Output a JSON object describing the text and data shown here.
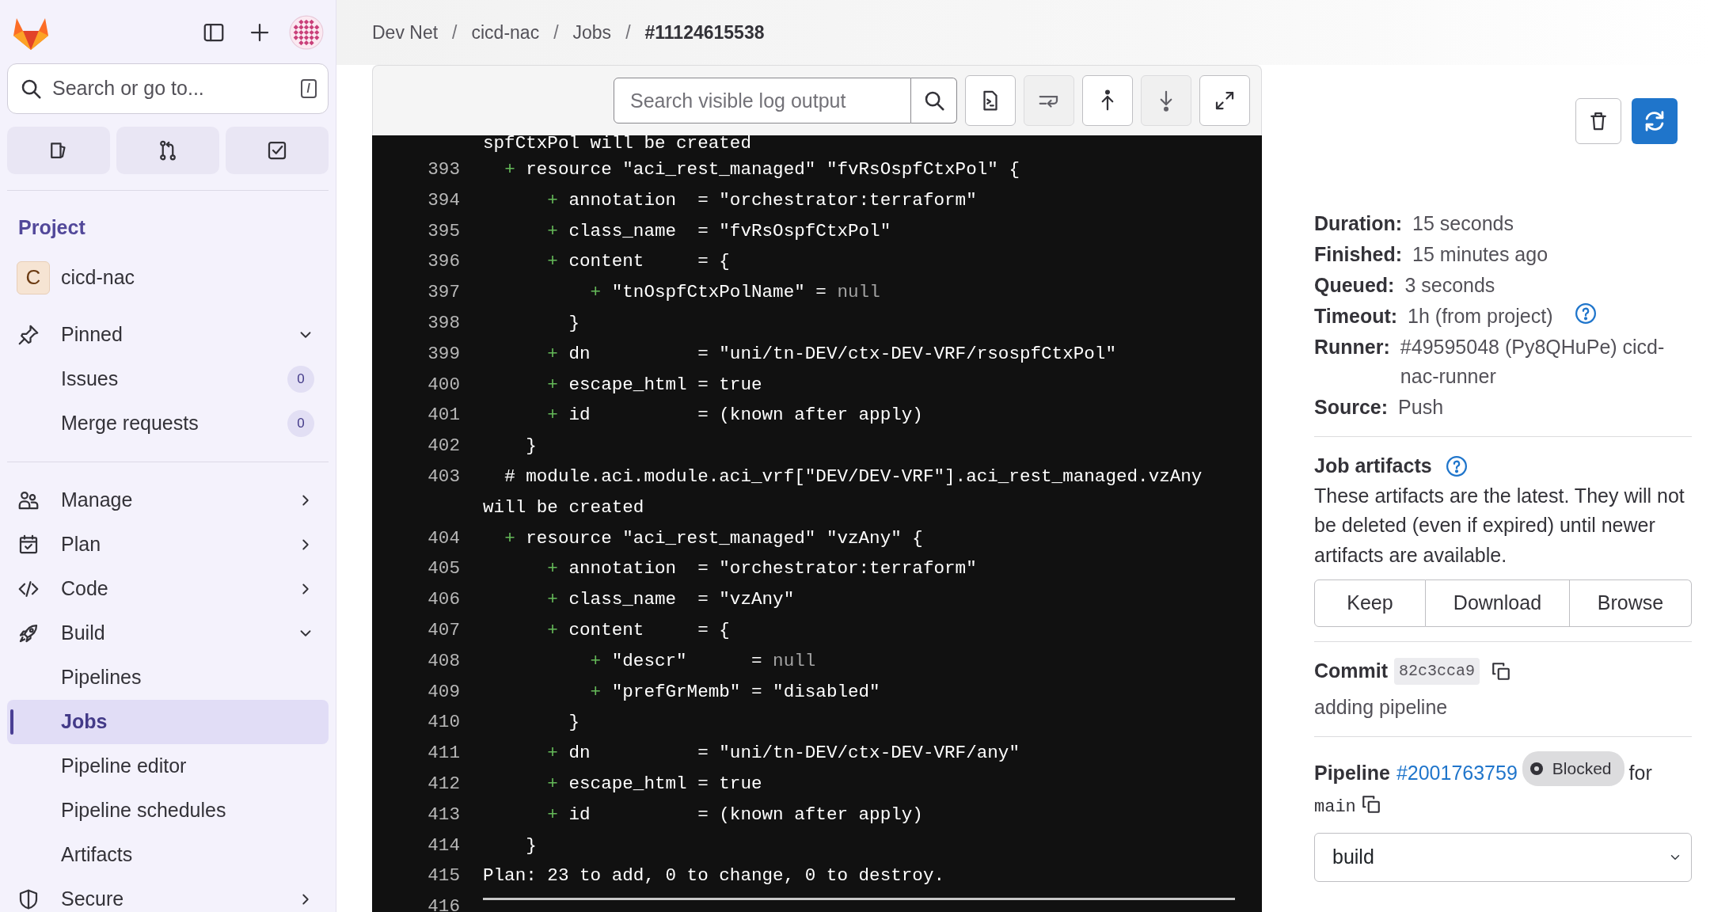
{
  "sidebar": {
    "search": {
      "placeholder": "Search or go to...",
      "shortcut": "/"
    },
    "section_title": "Project",
    "project": {
      "initial": "C",
      "name": "cicd-nac"
    },
    "pinned": {
      "label": "Pinned",
      "expanded": true,
      "items": [
        {
          "label": "Issues",
          "count": "0",
          "selected": false
        },
        {
          "label": "Merge requests",
          "count": "0",
          "selected": false
        }
      ]
    },
    "menu": [
      {
        "label": "Manage",
        "expanded": false
      },
      {
        "label": "Plan",
        "expanded": false
      },
      {
        "label": "Code",
        "expanded": false
      },
      {
        "label": "Build",
        "expanded": true,
        "children": [
          {
            "label": "Pipelines",
            "selected": false
          },
          {
            "label": "Jobs",
            "selected": true
          },
          {
            "label": "Pipeline editor",
            "selected": false
          },
          {
            "label": "Pipeline schedules",
            "selected": false
          },
          {
            "label": "Artifacts",
            "selected": false
          }
        ]
      },
      {
        "label": "Secure",
        "expanded": false
      }
    ]
  },
  "breadcrumbs": {
    "separator": "/",
    "items": [
      {
        "label": "Dev Net",
        "current": false
      },
      {
        "label": "cicd-nac",
        "current": false
      },
      {
        "label": "Jobs",
        "current": false
      },
      {
        "label": "#11124615538",
        "current": true
      }
    ]
  },
  "log": {
    "search": {
      "placeholder": "Search visible log output"
    },
    "lines": [
      {
        "segments": [
          {
            "kind": "text",
            "text": "spfCtxPol will be created"
          }
        ]
      },
      {
        "number": "393",
        "segments": [
          {
            "kind": "plus",
            "text": "  +"
          },
          {
            "kind": "text",
            "text": " resource \"aci_rest_managed\" \"fvRsOspfCtxPol\" {"
          }
        ]
      },
      {
        "number": "394",
        "segments": [
          {
            "kind": "plus",
            "text": "      +"
          },
          {
            "kind": "text",
            "text": " annotation  = \"orchestrator:terraform\""
          }
        ]
      },
      {
        "number": "395",
        "segments": [
          {
            "kind": "plus",
            "text": "      +"
          },
          {
            "kind": "text",
            "text": " class_name  = \"fvRsOspfCtxPol\""
          }
        ]
      },
      {
        "number": "396",
        "segments": [
          {
            "kind": "plus",
            "text": "      +"
          },
          {
            "kind": "text",
            "text": " content     = {"
          }
        ]
      },
      {
        "number": "397",
        "segments": [
          {
            "kind": "plus",
            "text": "          +"
          },
          {
            "kind": "text",
            "text": " \"tnOspfCtxPolName\" = "
          },
          {
            "kind": "muted",
            "text": "null"
          }
        ]
      },
      {
        "number": "398",
        "segments": [
          {
            "kind": "text",
            "text": "        }"
          }
        ]
      },
      {
        "number": "399",
        "segments": [
          {
            "kind": "plus",
            "text": "      +"
          },
          {
            "kind": "text",
            "text": " dn          = \"uni/tn-DEV/ctx-DEV-VRF/rsospfCtxPol\""
          }
        ]
      },
      {
        "number": "400",
        "segments": [
          {
            "kind": "plus",
            "text": "      +"
          },
          {
            "kind": "text",
            "text": " escape_html = true"
          }
        ]
      },
      {
        "number": "401",
        "segments": [
          {
            "kind": "plus",
            "text": "      +"
          },
          {
            "kind": "text",
            "text": " id          = (known after apply)"
          }
        ]
      },
      {
        "number": "402",
        "segments": [
          {
            "kind": "text",
            "text": "    }"
          }
        ]
      },
      {
        "number": "403",
        "segments": [
          {
            "kind": "text",
            "text": "  # module.aci.module.aci_vrf[\"DEV/DEV-VRF\"].aci_rest_managed.vzAny will be created"
          }
        ]
      },
      {
        "number": "404",
        "segments": [
          {
            "kind": "plus",
            "text": "  +"
          },
          {
            "kind": "text",
            "text": " resource \"aci_rest_managed\" \"vzAny\" {"
          }
        ]
      },
      {
        "number": "405",
        "segments": [
          {
            "kind": "plus",
            "text": "      +"
          },
          {
            "kind": "text",
            "text": " annotation  = \"orchestrator:terraform\""
          }
        ]
      },
      {
        "number": "406",
        "segments": [
          {
            "kind": "plus",
            "text": "      +"
          },
          {
            "kind": "text",
            "text": " class_name  = \"vzAny\""
          }
        ]
      },
      {
        "number": "407",
        "segments": [
          {
            "kind": "plus",
            "text": "      +"
          },
          {
            "kind": "text",
            "text": " content     = {"
          }
        ]
      },
      {
        "number": "408",
        "segments": [
          {
            "kind": "plus",
            "text": "          +"
          },
          {
            "kind": "text",
            "text": " \"descr\"      = "
          },
          {
            "kind": "muted",
            "text": "null"
          }
        ]
      },
      {
        "number": "409",
        "segments": [
          {
            "kind": "plus",
            "text": "          +"
          },
          {
            "kind": "text",
            "text": " \"prefGrMemb\" = \"disabled\""
          }
        ]
      },
      {
        "number": "410",
        "segments": [
          {
            "kind": "text",
            "text": "        }"
          }
        ]
      },
      {
        "number": "411",
        "segments": [
          {
            "kind": "plus",
            "text": "      +"
          },
          {
            "kind": "text",
            "text": " dn          = \"uni/tn-DEV/ctx-DEV-VRF/any\""
          }
        ]
      },
      {
        "number": "412",
        "segments": [
          {
            "kind": "plus",
            "text": "      +"
          },
          {
            "kind": "text",
            "text": " escape_html = true"
          }
        ]
      },
      {
        "number": "413",
        "segments": [
          {
            "kind": "plus",
            "text": "      +"
          },
          {
            "kind": "text",
            "text": " id          = (known after apply)"
          }
        ]
      },
      {
        "number": "414",
        "segments": [
          {
            "kind": "text",
            "text": "    }"
          }
        ]
      },
      {
        "number": "415",
        "segments": [
          {
            "kind": "text",
            "text": "Plan: 23 to add, 0 to change, 0 to destroy."
          }
        ]
      },
      {
        "number": "416",
        "kind": "rule"
      }
    ]
  },
  "details": [
    {
      "label": "Duration:",
      "value": "15 seconds",
      "help": false
    },
    {
      "label": "Finished:",
      "value": "15 minutes ago",
      "help": false
    },
    {
      "label": "Queued:",
      "value": "3 seconds",
      "help": false
    },
    {
      "label": "Timeout:",
      "value": "1h (from project)",
      "help": true
    },
    {
      "label": "Runner:",
      "value": "#49595048 (Py8QHuPe) cicd-nac-runner",
      "help": false
    },
    {
      "label": "Source:",
      "value": "Push",
      "help": false
    }
  ],
  "artifacts": {
    "title": "Job artifacts",
    "text": "These artifacts are the latest. They will not be deleted (even if expired) until newer artifacts are available.",
    "buttons": [
      "Keep",
      "Download",
      "Browse"
    ]
  },
  "commit": {
    "label": "Commit",
    "sha": "82c3cca9",
    "message": "adding pipeline"
  },
  "pipeline": {
    "label": "Pipeline",
    "id": "#2001763759",
    "status": "Blocked",
    "for": "for",
    "ref": "main"
  },
  "stage_select": {
    "value": "build"
  }
}
